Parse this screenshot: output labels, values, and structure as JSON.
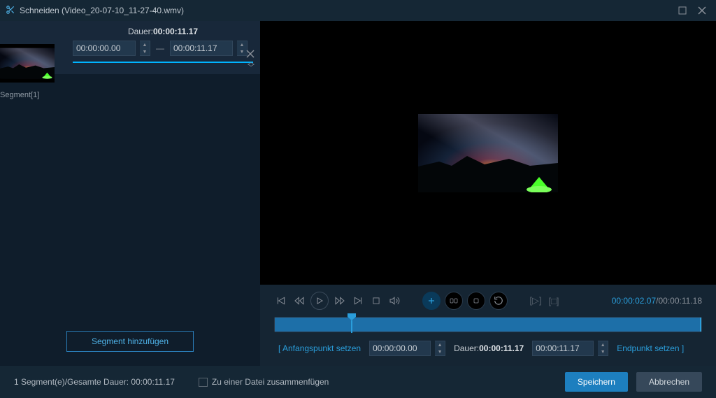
{
  "title": "Schneiden (Video_20-07-10_11-27-40.wmv)",
  "segment": {
    "label": "Segment[1]",
    "duration_label": "Dauer:",
    "duration_value": "00:00:11.17",
    "start": "00:00:00.00",
    "end": "00:00:11.17"
  },
  "add_segment_label": "Segment hinzufügen",
  "playback": {
    "current": "00:00:02.07",
    "total": "/00:00:11.18"
  },
  "setpoints": {
    "start_label": "[   Anfangspunkt setzen",
    "start_value": "00:00:00.00",
    "duration_label": "Dauer:",
    "duration_value": "00:00:11.17",
    "end_value": "00:00:11.17",
    "end_label": "Endpunkt setzen   ]"
  },
  "footer": {
    "status": "1 Segment(e)/Gesamte Dauer: 00:00:11.17",
    "merge_label": "Zu einer Datei zusammenfügen",
    "save": "Speichern",
    "cancel": "Abbrechen"
  }
}
